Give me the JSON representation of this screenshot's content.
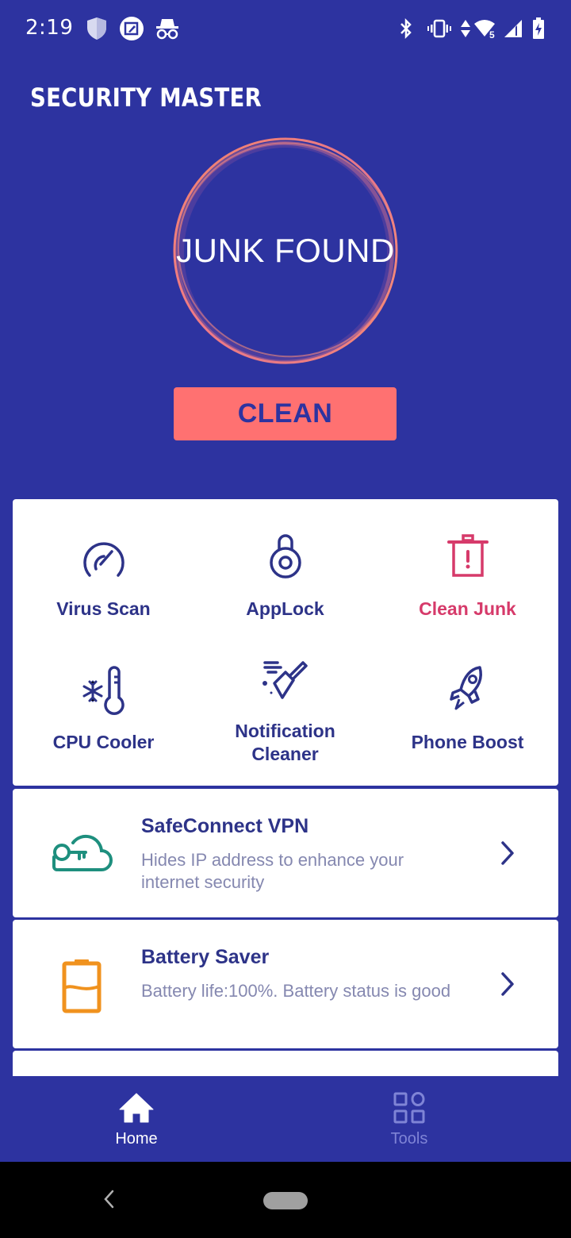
{
  "status_bar": {
    "time": "2:19",
    "left_icons": [
      "shield-icon",
      "screenshot-edit-icon",
      "incognito-icon"
    ],
    "right_icons": [
      "bluetooth-icon",
      "vibrate-icon",
      "data-arrows-icon",
      "wifi-icon",
      "signal-icon",
      "battery-charging-icon"
    ],
    "wifi_badge": "5"
  },
  "header": {
    "title": "SECURITY MASTER"
  },
  "status_ring": {
    "label": "JUNK FOUND"
  },
  "primary_action": {
    "label": "CLEAN"
  },
  "features": [
    {
      "label": "Virus Scan",
      "icon": "speedometer-icon",
      "highlighted": false
    },
    {
      "label": "AppLock",
      "icon": "padlock-icon",
      "highlighted": false
    },
    {
      "label": "Clean Junk",
      "icon": "trash-alert-icon",
      "highlighted": true
    },
    {
      "label": "CPU Cooler",
      "icon": "snowflake-thermometer-icon",
      "highlighted": false
    },
    {
      "label": "Notification Cleaner",
      "label_line1": "Notification",
      "label_line2": "Cleaner",
      "icon": "broom-icon",
      "highlighted": false
    },
    {
      "label": "Phone Boost",
      "icon": "rocket-icon",
      "highlighted": false
    }
  ],
  "cards": [
    {
      "title": "SafeConnect VPN",
      "description": "Hides IP address to enhance your internet security",
      "icon": "cloud-key-icon"
    },
    {
      "title": "Battery Saver",
      "description": "Battery life:100%. Battery status is good",
      "icon": "battery-icon"
    }
  ],
  "bottom_nav": {
    "tabs": [
      {
        "label": "Home",
        "icon": "home-icon",
        "active": true
      },
      {
        "label": "Tools",
        "icon": "tools-grid-icon",
        "active": false
      }
    ]
  },
  "colors": {
    "primary": "#2d33a0",
    "accent_button": "#ff7171",
    "highlight_text": "#d63a6a",
    "vpn_icon": "#1e8f7e",
    "battery_icon": "#f0921e",
    "text_dark": "#2d3388",
    "text_muted": "#8588b0"
  }
}
